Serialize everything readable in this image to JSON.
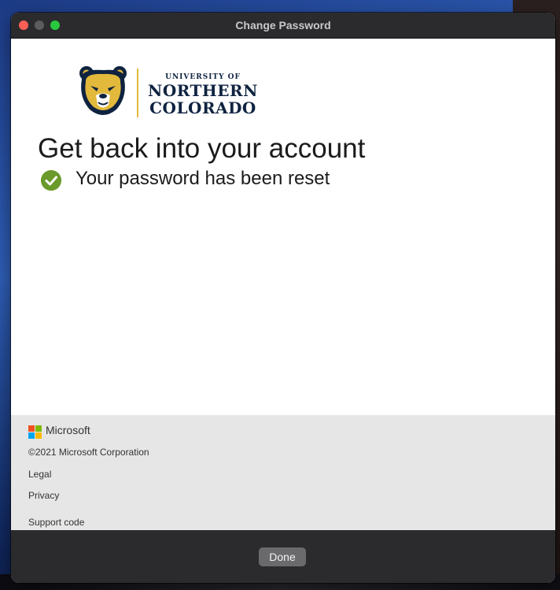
{
  "window": {
    "title": "Change Password"
  },
  "brand": {
    "small": "UNIVERSITY OF",
    "line1": "NORTHERN",
    "line2": "COLORADO"
  },
  "page": {
    "heading": "Get back into your account",
    "status": "Your password has been reset"
  },
  "footer": {
    "ms_name": "Microsoft",
    "copyright": "©2021 Microsoft Corporation",
    "legal": "Legal",
    "privacy": "Privacy",
    "support": "Support code"
  },
  "actions": {
    "done": "Done"
  },
  "colors": {
    "success": "#6a9a2a",
    "brand_navy": "#0f2340",
    "brand_gold": "#e3b93c"
  }
}
